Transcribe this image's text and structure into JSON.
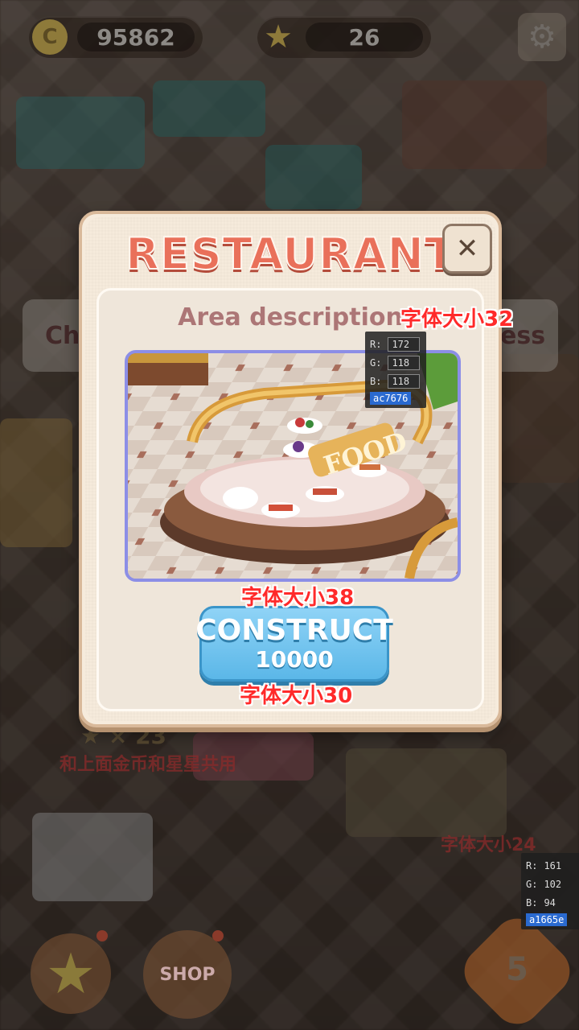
{
  "hud": {
    "coins": "95862",
    "stars": "26",
    "coin_icon": "coin-icon",
    "star_icon": "star-icon",
    "settings_icon": "gear-icon"
  },
  "modal": {
    "title": "RESTAURANT",
    "close_icon": "close-icon",
    "area_description_label": "Area description",
    "construct_label": "CONSTRUCT",
    "construct_cost": "10000"
  },
  "annotations": {
    "font32": "字体大小32",
    "font38": "字体大小38",
    "font30": "字体大小30",
    "font24": "字体大小24",
    "shared_note": "和上面金币和星星共用",
    "star_count": "× 23"
  },
  "color_picker_1": {
    "r": "172",
    "g": "118",
    "b": "118",
    "hex": "ac7676"
  },
  "color_picker_2": {
    "r": "161",
    "g": "102",
    "b": "94",
    "hex": "a1665e"
  },
  "background": {
    "left_label": "Chi",
    "right_label": "ess",
    "level": "5",
    "shop_label": "SHOP"
  },
  "colors": {
    "title": "#e9705a",
    "area_description": "#ac7676",
    "construct_button": "#5bb7e8",
    "image_border": "#8c8ee6"
  }
}
